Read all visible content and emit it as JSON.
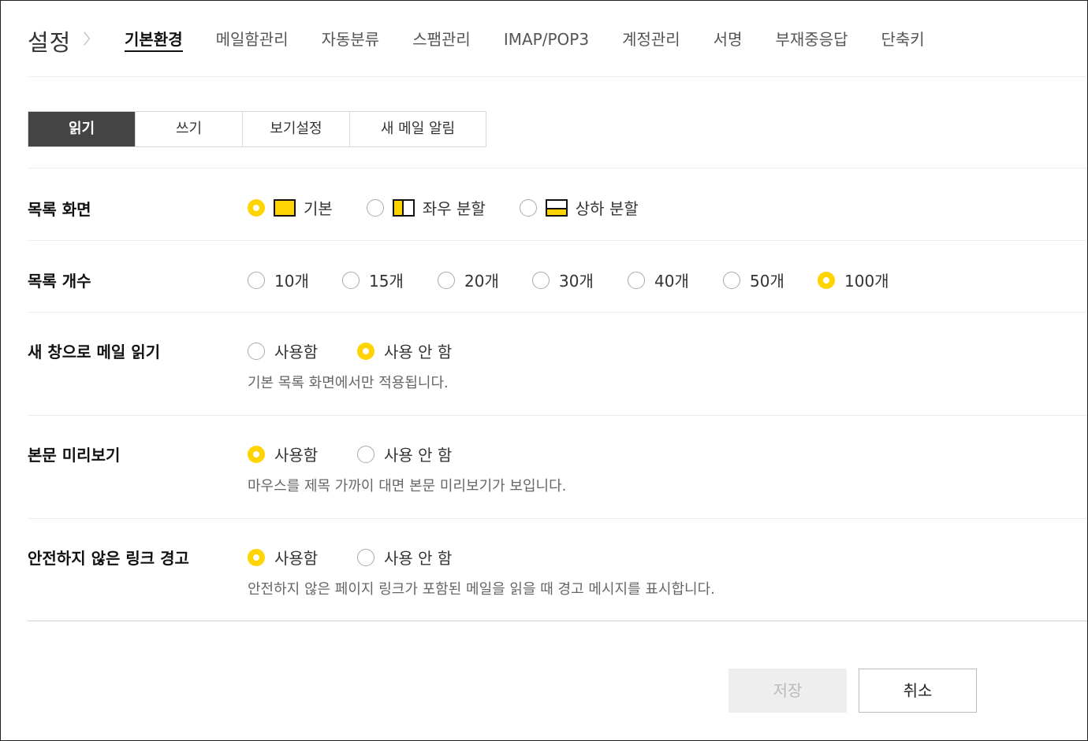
{
  "header": {
    "title": "설정",
    "tabs": [
      {
        "label": "기본환경"
      },
      {
        "label": "메일함관리"
      },
      {
        "label": "자동분류"
      },
      {
        "label": "스팸관리"
      },
      {
        "label": "IMAP/POP3"
      },
      {
        "label": "계정관리"
      },
      {
        "label": "서명"
      },
      {
        "label": "부재중응답"
      },
      {
        "label": "단축키"
      }
    ]
  },
  "subtabs": [
    {
      "label": "읽기"
    },
    {
      "label": "쓰기"
    },
    {
      "label": "보기설정"
    },
    {
      "label": "새 메일 알림"
    }
  ],
  "settings": {
    "list_view": {
      "label": "목록 화면",
      "options": [
        "기본",
        "좌우 분할",
        "상하 분할"
      ],
      "selected": "기본"
    },
    "list_count": {
      "label": "목록 개수",
      "options": [
        "10개",
        "15개",
        "20개",
        "30개",
        "40개",
        "50개",
        "100개"
      ],
      "selected": "100개"
    },
    "new_window": {
      "label": "새 창으로 메일 읽기",
      "options": [
        "사용함",
        "사용 안 함"
      ],
      "selected": "사용 안 함",
      "help": "기본 목록 화면에서만 적용됩니다."
    },
    "preview": {
      "label": "본문 미리보기",
      "options": [
        "사용함",
        "사용 안 함"
      ],
      "selected": "사용함",
      "help": "마우스를 제목 가까이 대면 본문 미리보기가 보입니다."
    },
    "unsafe_link": {
      "label": "안전하지 않은 링크 경고",
      "options": [
        "사용함",
        "사용 안 함"
      ],
      "selected": "사용함",
      "help": "안전하지 않은 페이지 링크가 포함된 메일을 읽을 때 경고 메시지를 표시합니다."
    }
  },
  "footer": {
    "save_label": "저장",
    "cancel_label": "취소"
  },
  "colors": {
    "accent": "#ffd400",
    "active_subtab_bg": "#444444"
  }
}
